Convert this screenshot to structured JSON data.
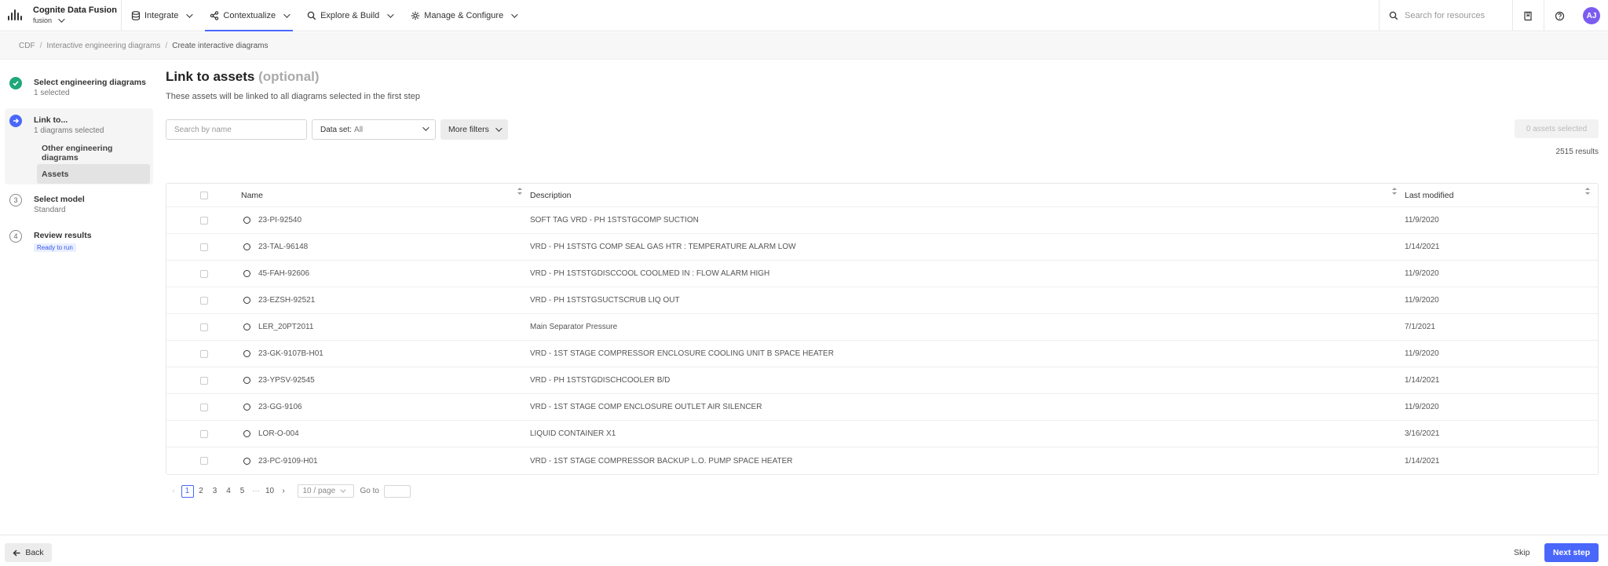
{
  "app": {
    "title": "Cognite Data Fusion",
    "project": "fusion"
  },
  "nav": [
    {
      "label": "Integrate",
      "icon": "database-icon",
      "active": false
    },
    {
      "label": "Contextualize",
      "icon": "share-nodes-icon",
      "active": true
    },
    {
      "label": "Explore & Build",
      "icon": "search-icon",
      "active": false
    },
    {
      "label": "Manage & Configure",
      "icon": "gear-icon",
      "active": false
    }
  ],
  "topbar": {
    "search_placeholder": "Search for resources",
    "avatar_initials": "AJ",
    "avatar_color": "#7b5cf0"
  },
  "breadcrumb": [
    "CDF",
    "Interactive engineering diagrams",
    "Create interactive diagrams"
  ],
  "steps": [
    {
      "title": "Select engineering diagrams",
      "subtitle": "1 selected",
      "state": "done"
    },
    {
      "title": "Link to...",
      "subtitle": "1 diagrams selected",
      "state": "current",
      "substeps": [
        {
          "label": "Other engineering diagrams",
          "selected": false
        },
        {
          "label": "Assets",
          "selected": true
        }
      ]
    },
    {
      "number": "3",
      "title": "Select model",
      "subtitle": "Standard",
      "state": "todo"
    },
    {
      "number": "4",
      "title": "Review results",
      "badge": "Ready to run",
      "state": "todo"
    }
  ],
  "main": {
    "title": "Link to assets",
    "title_optional": "(optional)",
    "description": "These assets will be linked to all diagrams selected in the first step",
    "search_placeholder": "Search by name",
    "dataset_label": "Data set:",
    "dataset_value": "All",
    "more_filters": "More filters",
    "assets_selected": "0 assets selected",
    "results": "2515 results"
  },
  "table": {
    "columns": [
      "Name",
      "Description",
      "Last modified"
    ],
    "rows": [
      {
        "name": "23-PI-92540",
        "description": "SOFT TAG VRD - PH 1STSTGCOMP SUCTION",
        "modified": "11/9/2020"
      },
      {
        "name": "23-TAL-96148",
        "description": "VRD - PH 1STSTG COMP SEAL GAS HTR : TEMPERATURE ALARM LOW",
        "modified": "1/14/2021"
      },
      {
        "name": "45-FAH-92606",
        "description": "VRD - PH 1STSTGDISCCOOL COOLMED IN : FLOW ALARM HIGH",
        "modified": "11/9/2020"
      },
      {
        "name": "23-EZSH-92521",
        "description": "VRD - PH 1STSTGSUCTSCRUB LIQ OUT",
        "modified": "11/9/2020"
      },
      {
        "name": "LER_20PT2011",
        "description": "Main Separator Pressure",
        "modified": "7/1/2021"
      },
      {
        "name": "23-GK-9107B-H01",
        "description": "VRD - 1ST STAGE COMPRESSOR ENCLOSURE COOLING UNIT B SPACE HEATER",
        "modified": "11/9/2020"
      },
      {
        "name": "23-YPSV-92545",
        "description": "VRD - PH 1STSTGDISCHCOOLER B/D",
        "modified": "1/14/2021"
      },
      {
        "name": "23-GG-9106",
        "description": "VRD - 1ST STAGE COMP ENCLOSURE OUTLET AIR SILENCER",
        "modified": "11/9/2020"
      },
      {
        "name": "LOR-O-004",
        "description": "LIQUID CONTAINER X1",
        "modified": "3/16/2021"
      },
      {
        "name": "23-PC-9109-H01",
        "description": "VRD - 1ST STAGE COMPRESSOR BACKUP L.O. PUMP SPACE HEATER",
        "modified": "1/14/2021"
      }
    ]
  },
  "pagination": {
    "pages": [
      "1",
      "2",
      "3",
      "4",
      "5"
    ],
    "ellipsis": "···",
    "last": "10",
    "current": "1",
    "page_size": "10 / page",
    "goto_label": "Go to"
  },
  "footer": {
    "back": "Back",
    "skip": "Skip",
    "next": "Next step"
  },
  "colors": {
    "primary": "#4a67fb",
    "success": "#1fa878"
  }
}
